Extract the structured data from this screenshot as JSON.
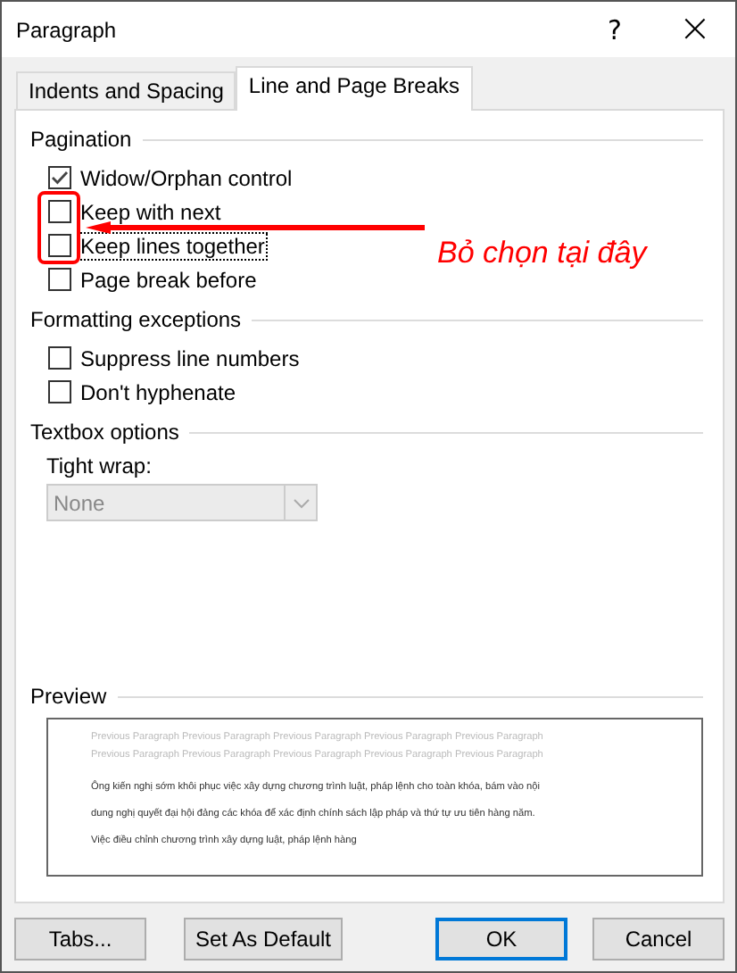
{
  "window": {
    "title": "Paragraph",
    "help": "?",
    "close": "×"
  },
  "tabs": [
    {
      "label": "Indents and Spacing",
      "selected": false
    },
    {
      "label": "Line and Page Breaks",
      "selected": true
    }
  ],
  "sections": [
    {
      "title": "Pagination",
      "checkboxes": [
        {
          "label": "Widow/Orphan control",
          "checked": true,
          "focused": false
        },
        {
          "label": "Keep with next",
          "checked": false,
          "focused": false
        },
        {
          "label": "Keep lines together",
          "checked": false,
          "focused": true
        },
        {
          "label": "Page break before",
          "checked": false,
          "focused": false
        }
      ]
    },
    {
      "title": "Formatting exceptions",
      "checkboxes": [
        {
          "label": "Suppress line numbers",
          "checked": false,
          "focused": false
        },
        {
          "label": "Don't hyphenate",
          "checked": false,
          "focused": false
        }
      ]
    },
    {
      "title": "Textbox options",
      "dropdown": {
        "label": "Tight wrap:",
        "value": "None",
        "disabled": true
      }
    }
  ],
  "preview": {
    "title": "Preview",
    "previous_lines": [
      "Previous Paragraph Previous Paragraph Previous Paragraph Previous Paragraph Previous Paragraph",
      "Previous Paragraph Previous Paragraph Previous Paragraph Previous Paragraph Previous Paragraph"
    ],
    "body_lines": [
      "Ông kiến nghị sớm khôi phục việc xây dựng chương trình luật, pháp lệnh cho toàn khóa, bám vào nội",
      "dung nghị quyết đại hội đảng các khóa để xác định chính sách lập pháp và thứ tự ưu tiên hàng năm.",
      "Việc điều chỉnh chương trình xây dựng luật, pháp lệnh hàng"
    ]
  },
  "buttons": [
    {
      "label": "Tabs...",
      "default": false
    },
    {
      "label": "Set As Default",
      "default": false
    },
    {
      "label": "OK",
      "default": true
    },
    {
      "label": "Cancel",
      "default": false
    }
  ],
  "annotation": {
    "text": "Bỏ chọn tại đây"
  }
}
